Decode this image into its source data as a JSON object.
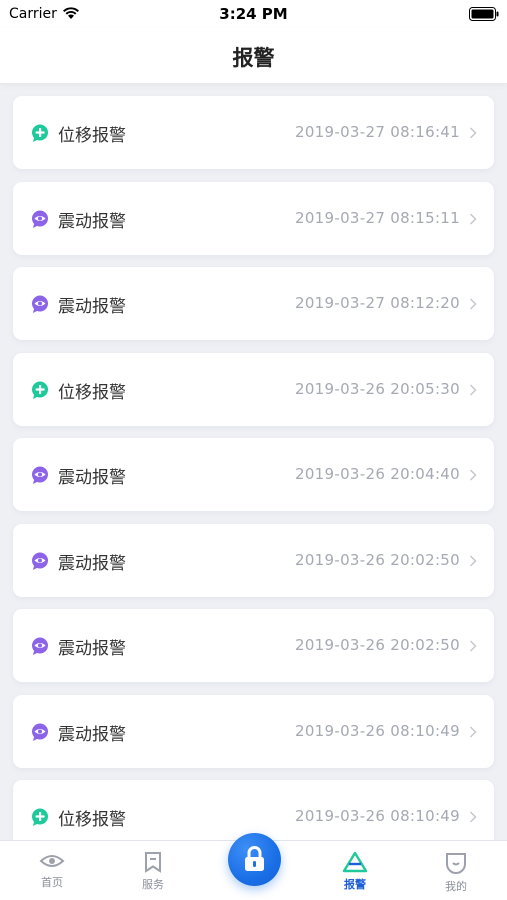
{
  "status_bar": {
    "carrier": "Carrier",
    "time": "3:24 PM"
  },
  "nav": {
    "title": "报警"
  },
  "colors": {
    "displacement": "#1ec99a",
    "vibration": "#8d63e8",
    "accent": "#1a6fe6"
  },
  "alarms": [
    {
      "type": "位移报警",
      "icon": "plus-icon",
      "time": "2019-03-27 08:16:41"
    },
    {
      "type": "震动报警",
      "icon": "eye-icon",
      "time": "2019-03-27 08:15:11"
    },
    {
      "type": "震动报警",
      "icon": "eye-icon",
      "time": "2019-03-27 08:12:20"
    },
    {
      "type": "位移报警",
      "icon": "plus-icon",
      "time": "2019-03-26 20:05:30"
    },
    {
      "type": "震动报警",
      "icon": "eye-icon",
      "time": "2019-03-26 20:04:40"
    },
    {
      "type": "震动报警",
      "icon": "eye-icon",
      "time": "2019-03-26 20:02:50"
    },
    {
      "type": "震动报警",
      "icon": "eye-icon",
      "time": "2019-03-26 20:02:50"
    },
    {
      "type": "震动报警",
      "icon": "eye-icon",
      "time": "2019-03-26 08:10:49"
    },
    {
      "type": "位移报警",
      "icon": "plus-icon",
      "time": "2019-03-26 08:10:49"
    }
  ],
  "tabs": [
    {
      "label": "首页",
      "icon": "eye-outline-icon",
      "active": false
    },
    {
      "label": "服务",
      "icon": "bookmark-icon",
      "active": false
    },
    {
      "label": "报警",
      "icon": "warning-triangle-icon",
      "active": true
    },
    {
      "label": "我的",
      "icon": "smile-icon",
      "active": false
    }
  ],
  "center_button": {
    "icon": "lock-icon"
  }
}
